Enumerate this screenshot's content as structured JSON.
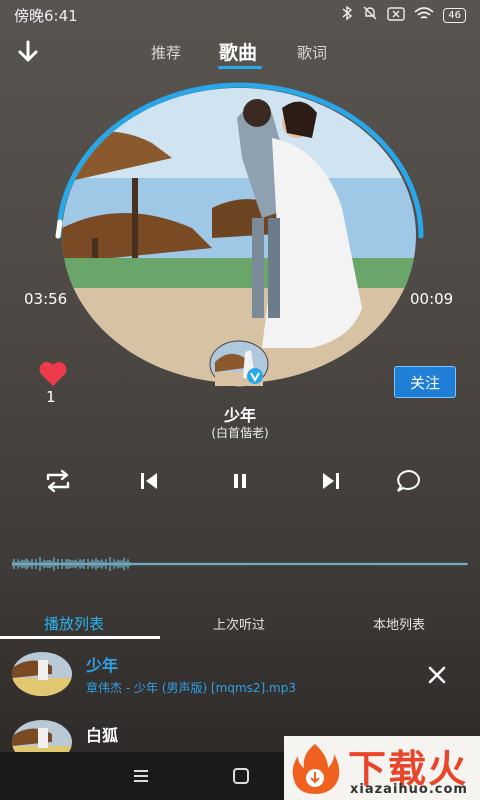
{
  "status": {
    "time": "傍晚6:41",
    "battery": "46"
  },
  "nav": {
    "tabs": [
      "推荐",
      "歌曲",
      "歌词"
    ],
    "active_index": 1
  },
  "player": {
    "elapsed": "03:56",
    "remaining": "00:09",
    "likes": "1",
    "follow_label": "关注",
    "song_title": "少年",
    "song_artist": "(白首偕老)",
    "progress_fraction": 0.96
  },
  "list_tabs": [
    "播放列表",
    "上次听过",
    "本地列表"
  ],
  "playlist": [
    {
      "title": "少年",
      "subtitle": "章伟杰 - 少年 (男声版) [mqms2].mp3",
      "active": true
    },
    {
      "title": "白狐",
      "subtitle": "",
      "active": false
    }
  ],
  "watermark": {
    "text": "下载火",
    "url": "xiazaihuo.com"
  },
  "colors": {
    "accent": "#2aa7e8",
    "like": "#ee3b4b"
  }
}
